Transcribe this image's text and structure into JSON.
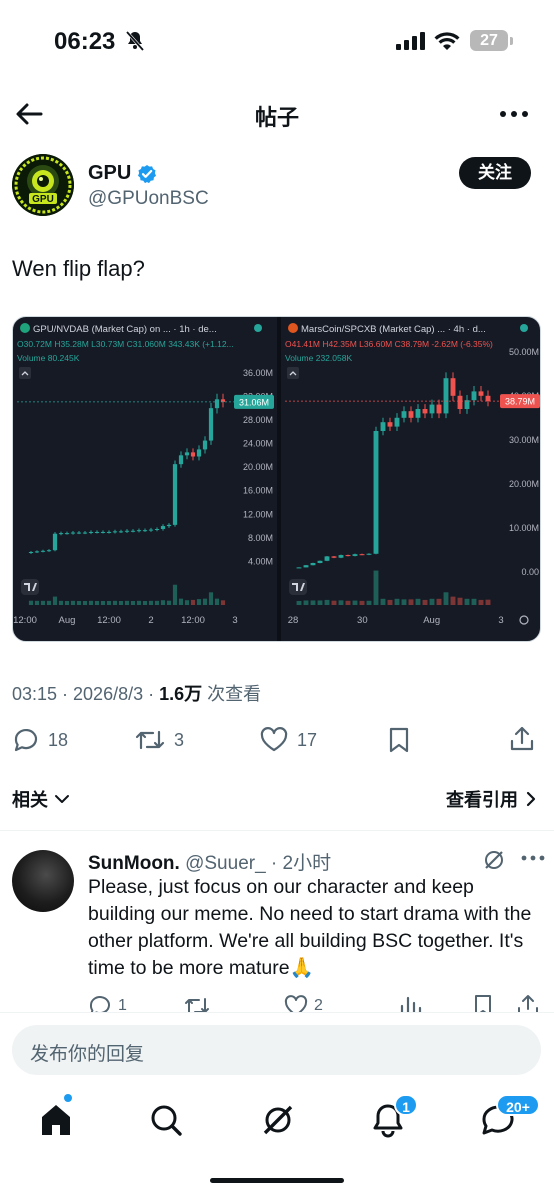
{
  "status_bar": {
    "time": "06:23",
    "battery": "27"
  },
  "header": {
    "title": "帖子"
  },
  "author": {
    "name": "GPU",
    "handle": "@GPUonBSC",
    "follow_label": "关注",
    "avatar_text": "GPU"
  },
  "tweet": {
    "text": "Wen flip flap?"
  },
  "chart_data": [
    {
      "type": "candlestick",
      "title": "GPU/NVDAB (Market Cap) on ... · 1h · de...",
      "ohlc": "O30.72M H35.28M L30.73M C31.060M 343.43K (+1.12...",
      "volume_label": "Volume",
      "volume_value": "80.245K",
      "current_price": "31.06M",
      "y_ticks": [
        "36.00M",
        "32.00M",
        "28.00M",
        "24.00M",
        "20.00M",
        "16.00M",
        "12.00M",
        "8.00M",
        "4.00M"
      ],
      "x_ticks": [
        "12:00",
        "Aug",
        "12:00",
        "2",
        "12:00",
        "3"
      ],
      "closes": [
        5.6,
        5.7,
        5.8,
        5.9,
        8.7,
        8.8,
        8.8,
        8.9,
        8.9,
        8.9,
        9.0,
        9.0,
        9.0,
        9.0,
        9.1,
        9.1,
        9.2,
        9.2,
        9.3,
        9.3,
        9.4,
        9.5,
        10.0,
        10.2,
        20.5,
        22.0,
        22.5,
        21.8,
        23.0,
        24.5,
        30.0,
        31.5,
        31.06
      ]
    },
    {
      "type": "candlestick",
      "title": "MarsCoin/SPCXB (Market Cap) ... · 4h · d...",
      "ohlc": "O41.41M H42.35M L36.60M C38.79M -2.62M (-6.35%)",
      "volume_label": "Volume",
      "volume_value": "232.058K",
      "current_price": "38.79M",
      "y_ticks": [
        "50.00M",
        "40.00M",
        "30.00M",
        "20.00M",
        "10.00M",
        "0.00"
      ],
      "x_ticks": [
        "28",
        "30",
        "Aug",
        "3"
      ],
      "closes": [
        1.0,
        1.5,
        2.0,
        2.5,
        3.5,
        3.2,
        3.8,
        3.6,
        4.0,
        3.9,
        4.1,
        32.0,
        34.0,
        33.0,
        35.0,
        36.5,
        35.0,
        37.0,
        36.0,
        38.0,
        36.0,
        44.0,
        40.0,
        37.0,
        39.0,
        41.0,
        40.0,
        38.79
      ]
    }
  ],
  "meta": {
    "time": "03:15 · 2026/8/3 · ",
    "views": "1.6万",
    "views_label": " 次查看"
  },
  "actions": {
    "replies": "18",
    "reposts": "3",
    "likes": "17"
  },
  "related": {
    "label": "相关",
    "quotes_label": "查看引用"
  },
  "reply": {
    "name": "SunMoon.",
    "handle": "@Suuer_",
    "time": " · 2小时",
    "text": "Please, just focus on our character and keep building our meme. No need to start drama with the other platform. We're all building BSC together. It's time to be more mature🙏",
    "replies": "1",
    "likes": "2"
  },
  "composer": {
    "placeholder": "发布你的回复"
  },
  "nav": {
    "notifications_badge": "1",
    "messages_badge": "20+"
  }
}
